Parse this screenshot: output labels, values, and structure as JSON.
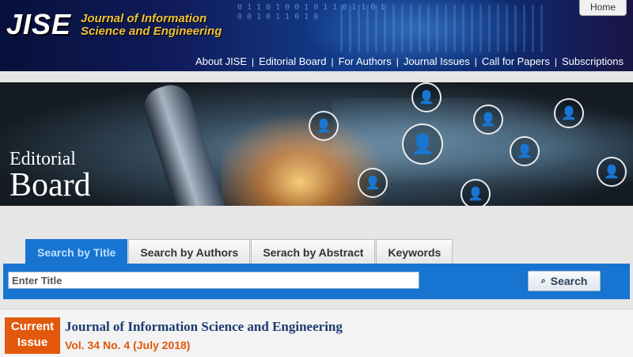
{
  "header": {
    "logo": "JISE",
    "journal_name_line1": "Journal of Information",
    "journal_name_line2": "Science and Engineering",
    "home_label": "Home",
    "nav": [
      "About JISE",
      "Editorial Board",
      "For Authors",
      "Journal Issues",
      "Call for Papers",
      "Subscriptions"
    ]
  },
  "banner": {
    "title_small": "Editorial",
    "title_big": "Board"
  },
  "search": {
    "tabs": [
      "Search by Title",
      "Search by Authors",
      "Serach by Abstract",
      "Keywords"
    ],
    "active_tab": 0,
    "input_placeholder": "Enter Title",
    "button_label": "Search"
  },
  "current_issue": {
    "badge_line1": "Current",
    "badge_line2": "Issue",
    "journal_title": "Journal of Information Science and Engineering",
    "volume": "Vol. 34 No. 4 (July 2018)"
  },
  "colors": {
    "accent_blue": "#1775d1",
    "orange": "#e2590d",
    "logo_yellow": "#f0c23b",
    "title_navy": "#1c3b70"
  }
}
